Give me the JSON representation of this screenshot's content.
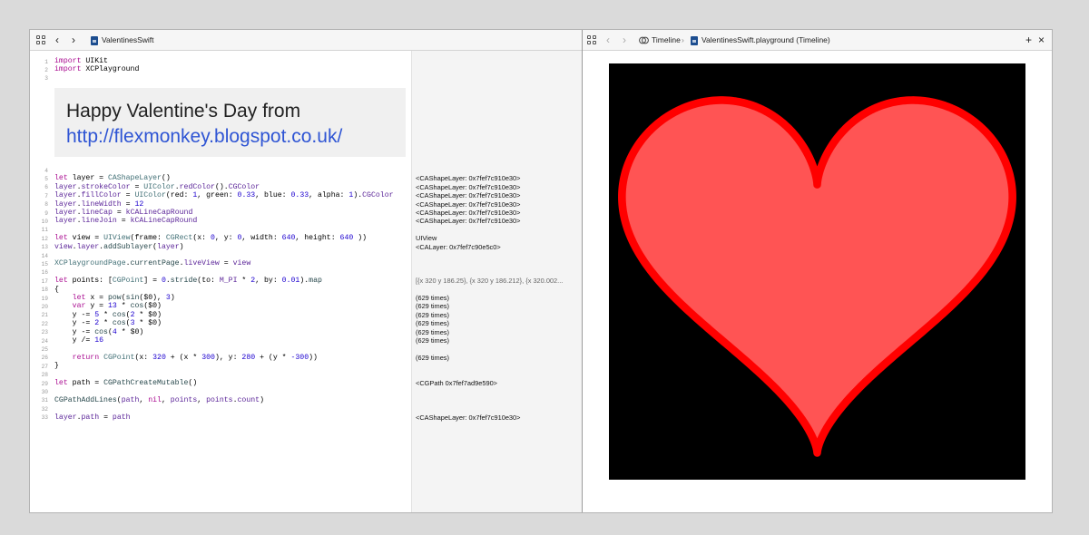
{
  "left_toolbar": {
    "file_name": "ValentinesSwift"
  },
  "right_toolbar": {
    "timeline_label": "Timeline",
    "timeline_file": "ValentinesSwift.playground (Timeline)",
    "add_label": "+",
    "close_label": "×"
  },
  "markup": {
    "title": "Happy Valentine's Day from",
    "link": "http://flexmonkey.blogspot.co.uk/"
  },
  "line_numbers": [
    "1",
    "2",
    "3",
    "4",
    "5",
    "6",
    "7",
    "8",
    "9",
    "10",
    "11",
    "12",
    "13",
    "14",
    "15",
    "16",
    "17",
    "18",
    "19",
    "20",
    "21",
    "22",
    "23",
    "24",
    "25",
    "26",
    "27",
    "28",
    "29",
    "30",
    "31",
    "32",
    "33"
  ],
  "code_lines": [
    {
      "n": 1,
      "html": "<span class=\"kw\">import</span> UIKit"
    },
    {
      "n": 2,
      "html": "<span class=\"kw\">import</span> XCPlayground"
    },
    {
      "n": 4,
      "html": ""
    },
    {
      "n": 5,
      "html": "<span class=\"kw\">let</span> layer = <span class=\"ty\">CAShapeLayer</span>()"
    },
    {
      "n": 6,
      "html": "<span class=\"pr\">layer</span>.<span class=\"pr\">strokeColor</span> = <span class=\"ty\">UIColor</span>.<span class=\"pr\">redColor</span>().<span class=\"pr\">CGColor</span>"
    },
    {
      "n": 7,
      "html": "<span class=\"pr\">layer</span>.<span class=\"pr\">fillColor</span> = <span class=\"ty\">UIColor</span>(red: <span class=\"nu\">1</span>, green: <span class=\"nu\">0.33</span>, blue: <span class=\"nu\">0.33</span>, alpha: <span class=\"nu\">1</span>).<span class=\"pr\">CGColor</span>"
    },
    {
      "n": 8,
      "html": "<span class=\"pr\">layer</span>.<span class=\"pr\">lineWidth</span> = <span class=\"nu\">12</span>"
    },
    {
      "n": 9,
      "html": "<span class=\"pr\">layer</span>.<span class=\"pr\">lineCap</span> = <span class=\"cs\">kCALineCapRound</span>"
    },
    {
      "n": 10,
      "html": "<span class=\"pr\">layer</span>.<span class=\"pr\">lineJoin</span> = <span class=\"cs\">kCALineCapRound</span>"
    },
    {
      "n": 12,
      "html": "<span class=\"kw\">let</span> view = <span class=\"ty\">UIView</span>(frame: <span class=\"ty\">CGRect</span>(x: <span class=\"nu\">0</span>, y: <span class=\"nu\">0</span>, width: <span class=\"nu\">640</span>, height: <span class=\"nu\">640</span> ))"
    },
    {
      "n": 13,
      "html": "<span class=\"pr\">view</span>.<span class=\"pr\">layer</span>.<span class=\"fn\">addSublayer</span>(<span class=\"pr\">layer</span>)"
    },
    {
      "n": 15,
      "html": "<span class=\"ty\">XCPlaygroundPage</span>.<span class=\"fn\">currentPage</span>.<span class=\"pr\">liveView</span> = <span class=\"pr\">view</span>"
    },
    {
      "n": 17,
      "html": "<span class=\"kw\">let</span> points: [<span class=\"ty\">CGPoint</span>] = <span class=\"nu\">0</span>.<span class=\"fn\">stride</span>(to: <span class=\"cs\">M_PI</span> * <span class=\"nu\">2</span>, by: <span class=\"nu\">0.01</span>).<span class=\"fn\">map</span>"
    },
    {
      "n": 18,
      "html": "{"
    },
    {
      "n": 19,
      "html": "    <span class=\"kw\">let</span> x = <span class=\"fn\">pow</span>(<span class=\"fn\">sin</span>($0), <span class=\"nu\">3</span>)"
    },
    {
      "n": 20,
      "html": "    <span class=\"kw\">var</span> y = <span class=\"nu\">13</span> * <span class=\"fn\">cos</span>($0)"
    },
    {
      "n": 21,
      "html": "    y -= <span class=\"nu\">5</span> * <span class=\"fn\">cos</span>(<span class=\"nu\">2</span> * $0)"
    },
    {
      "n": 22,
      "html": "    y -= <span class=\"nu\">2</span> * <span class=\"fn\">cos</span>(<span class=\"nu\">3</span> * $0)"
    },
    {
      "n": 23,
      "html": "    y -= <span class=\"fn\">cos</span>(<span class=\"nu\">4</span> * $0)"
    },
    {
      "n": 24,
      "html": "    y /= <span class=\"nu\">16</span>"
    },
    {
      "n": 26,
      "html": "    <span class=\"kw\">return</span> <span class=\"ty\">CGPoint</span>(x: <span class=\"nu\">320</span> + (x * <span class=\"nu\">300</span>), y: <span class=\"nu\">280</span> + (y * <span class=\"nu\">-300</span>))"
    },
    {
      "n": 27,
      "html": "}"
    },
    {
      "n": 29,
      "html": "<span class=\"kw\">let</span> path = <span class=\"fn\">CGPathCreateMutable</span>()"
    },
    {
      "n": 31,
      "html": "<span class=\"fn\">CGPathAddLines</span>(<span class=\"pr\">path</span>, <span class=\"kw\">nil</span>, <span class=\"pr\">points</span>, <span class=\"pr\">points</span>.<span class=\"pr\">count</span>)"
    },
    {
      "n": 33,
      "html": "<span class=\"pr\">layer</span>.<span class=\"pr\">path</span> = <span class=\"pr\">path</span>"
    }
  ],
  "results": [
    {
      "n": 5,
      "text": "<CAShapeLayer: 0x7fef7c910e30>"
    },
    {
      "n": 6,
      "text": "<CAShapeLayer: 0x7fef7c910e30>"
    },
    {
      "n": 7,
      "text": "<CAShapeLayer: 0x7fef7c910e30>"
    },
    {
      "n": 8,
      "text": "<CAShapeLayer: 0x7fef7c910e30>"
    },
    {
      "n": 9,
      "text": "<CAShapeLayer: 0x7fef7c910e30>"
    },
    {
      "n": 10,
      "text": "<CAShapeLayer: 0x7fef7c910e30>"
    },
    {
      "n": 12,
      "text": "UIView"
    },
    {
      "n": 13,
      "text": "<CALayer: 0x7fef7c90e5c0>"
    },
    {
      "n": 17,
      "text": "[{x 320 y 186.25}, {x 320 y 186.212}, {x 320.002..."
    },
    {
      "n": 19,
      "text": "(629 times)"
    },
    {
      "n": 20,
      "text": "(629 times)"
    },
    {
      "n": 21,
      "text": "(629 times)"
    },
    {
      "n": 22,
      "text": "(629 times)"
    },
    {
      "n": 23,
      "text": "(629 times)"
    },
    {
      "n": 24,
      "text": "(629 times)"
    },
    {
      "n": 26,
      "text": "(629 times)"
    },
    {
      "n": 29,
      "text": "<CGPath 0x7fef7ad9e590>"
    },
    {
      "n": 33,
      "text": "<CAShapeLayer: 0x7fef7c910e30>"
    }
  ],
  "live_view": {
    "background": "#000000",
    "stroke_color": "#ff0000",
    "fill_color": "#ff5454",
    "line_width": 12
  }
}
